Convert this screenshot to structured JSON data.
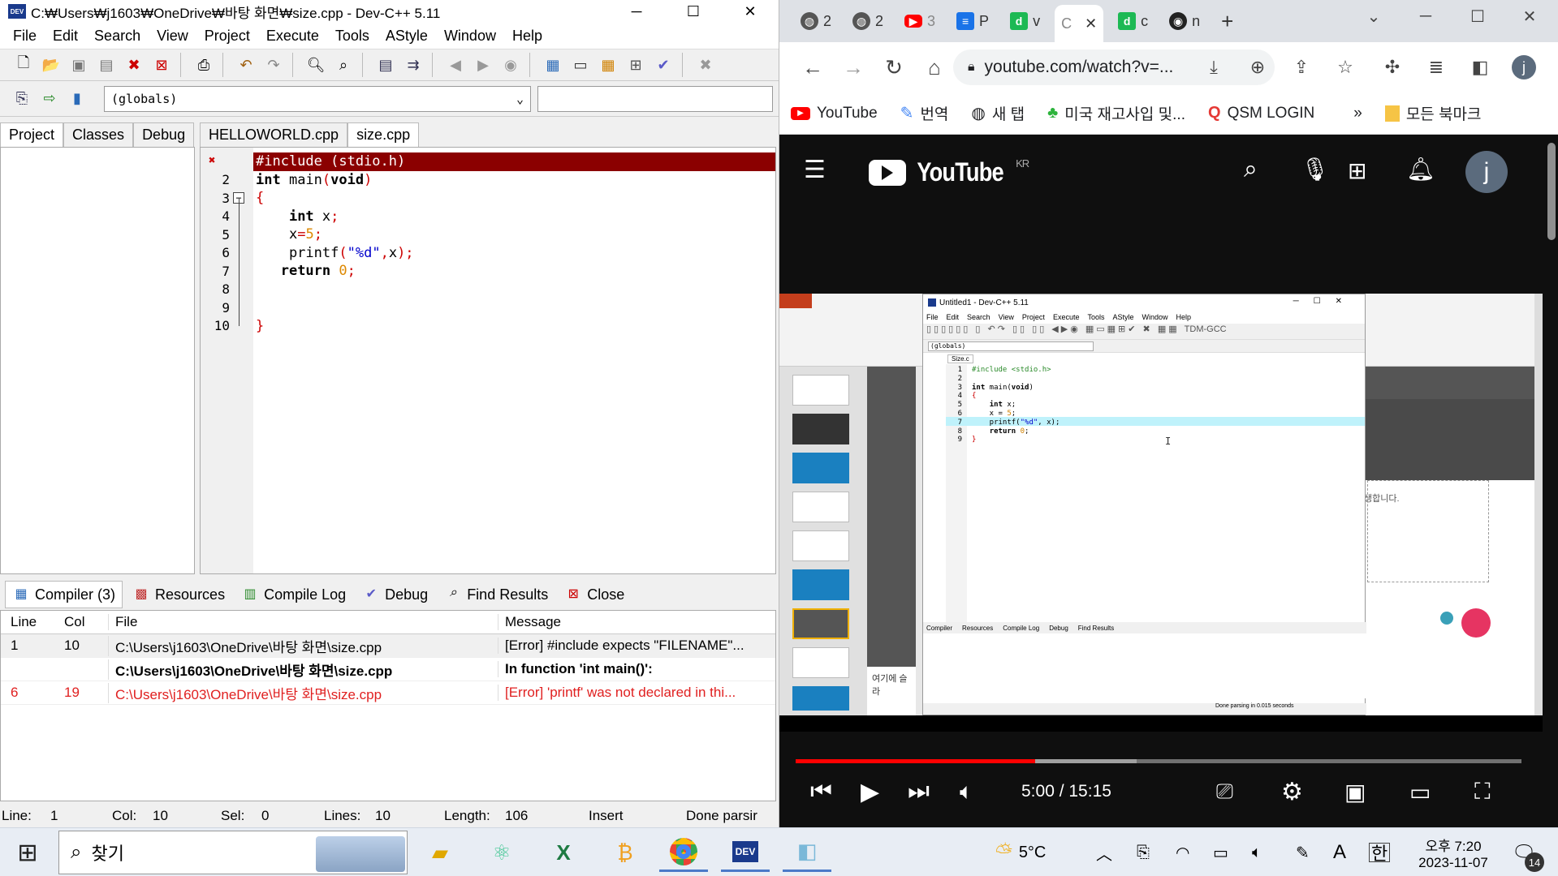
{
  "dev": {
    "title": "C:₩Users₩j1603₩OneDrive₩바탕 화면₩size.cpp - Dev-C++ 5.11",
    "menu": [
      "File",
      "Edit",
      "Search",
      "View",
      "Project",
      "Execute",
      "Tools",
      "AStyle",
      "Window",
      "Help"
    ],
    "scope_combo": "(globals)",
    "left_tabs": [
      "Project",
      "Classes",
      "Debug"
    ],
    "editor_tabs": [
      "HELLOWORLD.cpp",
      "size.cpp"
    ],
    "code_lines": [
      {
        "n": "",
        "text": "#include (stdio.h)"
      },
      {
        "n": "2",
        "text": "int main(void)"
      },
      {
        "n": "3",
        "text": "{"
      },
      {
        "n": "4",
        "text": "    int x;"
      },
      {
        "n": "5",
        "text": "    x=5;"
      },
      {
        "n": "6",
        "text": "    printf(\"%d\",x);"
      },
      {
        "n": "7",
        "text": "   return 0;"
      },
      {
        "n": "8",
        "text": ""
      },
      {
        "n": "9",
        "text": ""
      },
      {
        "n": "10",
        "text": "}"
      }
    ],
    "bottom_tabs": [
      "Compiler (3)",
      "Resources",
      "Compile Log",
      "Debug",
      "Find Results",
      "Close"
    ],
    "msg_headers": [
      "Line",
      "Col",
      "File",
      "Message"
    ],
    "messages": [
      {
        "line": "1",
        "col": "10",
        "file": "C:\\Users\\j1603\\OneDrive\\바탕 화면\\size.cpp",
        "msg": "[Error] #include expects \"FILENAME\"..."
      },
      {
        "line": "",
        "col": "",
        "file": "C:\\Users\\j1603\\OneDrive\\바탕 화면\\size.cpp",
        "msg": "In function 'int main()':"
      },
      {
        "line": "6",
        "col": "19",
        "file": "C:\\Users\\j1603\\OneDrive\\바탕 화면\\size.cpp",
        "msg": "[Error] 'printf' was not declared in thi..."
      }
    ],
    "status": {
      "line_label": "Line:",
      "line": "1",
      "col_label": "Col:",
      "col": "10",
      "sel_label": "Sel:",
      "sel": "0",
      "lines_label": "Lines:",
      "lines": "10",
      "length_label": "Length:",
      "length": "106",
      "mode": "Insert",
      "parse": "Done parsir"
    }
  },
  "chrome": {
    "tabs": [
      {
        "fav": "2",
        "label": "2"
      },
      {
        "fav": "2",
        "label": "2"
      },
      {
        "fav": "yt",
        "label": "3"
      },
      {
        "fav": "doc",
        "label": "P"
      },
      {
        "fav": "d",
        "label": "v"
      },
      {
        "fav": "",
        "label": "C"
      },
      {
        "fav": "d",
        "label": "c"
      },
      {
        "fav": "gh",
        "label": "n"
      }
    ],
    "url": "youtube.com/watch?v=...",
    "bookmarks": [
      "YouTube",
      "번역",
      "새 탭",
      "미국 재고사입 및...",
      "QSM LOGIN",
      "모든 북마크"
    ],
    "yt_region": "KR",
    "avatar": "j",
    "time": "5:00 / 15:15",
    "progress": 0.33,
    "inner_window_title": "Untitled1 - Dev-C++ 5.11",
    "inner_tab": "Size.c",
    "inner_code": [
      "#include <stdio.h>",
      "",
      "int main(void)",
      "{",
      "    int x;",
      "    x = 5;",
      "    printf(\"%d\", x);",
      "    return 0;",
      "}"
    ],
    "inner_bottom": [
      "Compiler",
      "Resources",
      "Compile Log",
      "Debug",
      "Find Results"
    ],
    "inner_status": "Done parsing in 0.015 seconds",
    "slide_hint": "여기에 슬라",
    "slide_text": "생합니다."
  },
  "taskbar": {
    "search_placeholder": "찾기",
    "weather": "5°C",
    "ime": "A",
    "ime2": "한",
    "time": "오후 7:20",
    "date": "2023-11-07",
    "notif_count": "14"
  }
}
